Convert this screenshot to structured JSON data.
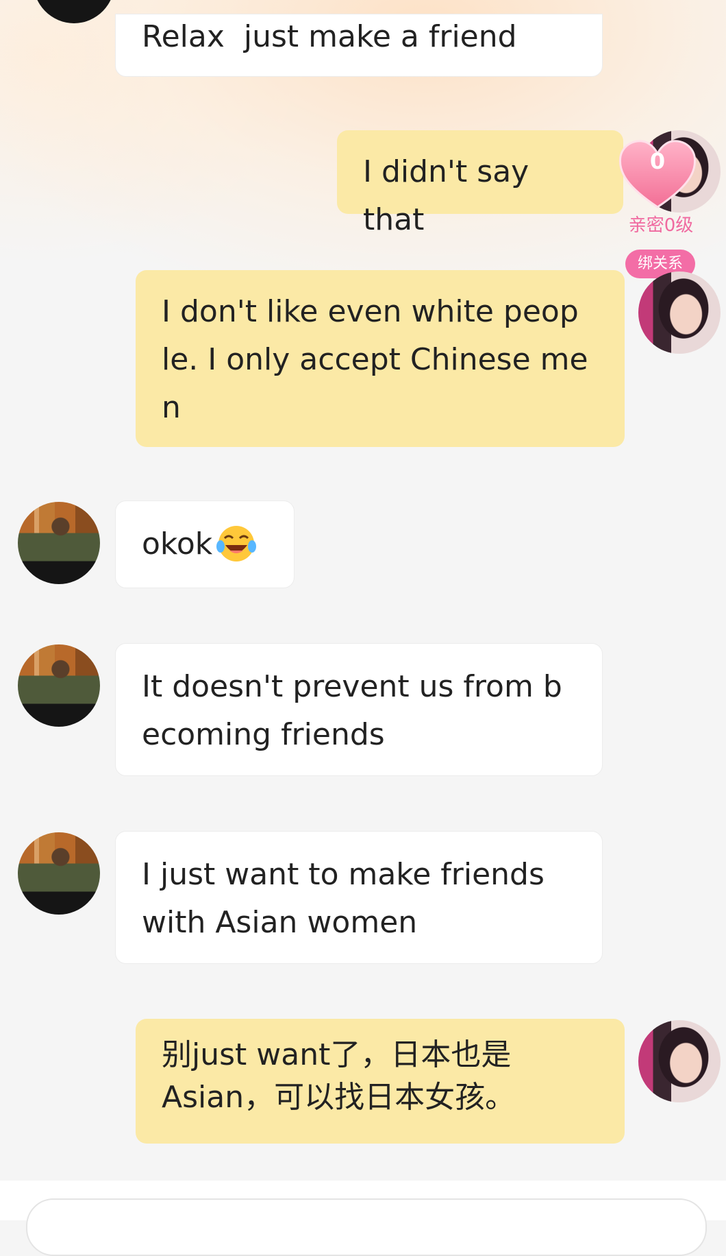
{
  "intimacy": {
    "heart_count": "0",
    "level_label": "亲密0级",
    "bind_label": "绑关系"
  },
  "messages": [
    {
      "side": "in",
      "text": "Relax  just make a friend"
    },
    {
      "side": "out",
      "text": "I didn't say that"
    },
    {
      "side": "out",
      "text": "I don't like even white peop\nle. I only accept Chinese me\nn"
    },
    {
      "side": "in",
      "text": "okok",
      "emoji": "laughing-tears-emoji"
    },
    {
      "side": "in",
      "text": "It doesn't prevent us from b\necoming friends"
    },
    {
      "side": "in",
      "text": "I just want to make friends\nwith Asian women"
    },
    {
      "side": "out",
      "text": "别just want了，日本也是\nAsian，可以找日本女孩。"
    }
  ],
  "colors": {
    "incoming_bubble": "#ffffff",
    "outgoing_bubble": "#fbe9a6",
    "badge_pink": "#f36da6",
    "level_text": "#f06aa0"
  }
}
